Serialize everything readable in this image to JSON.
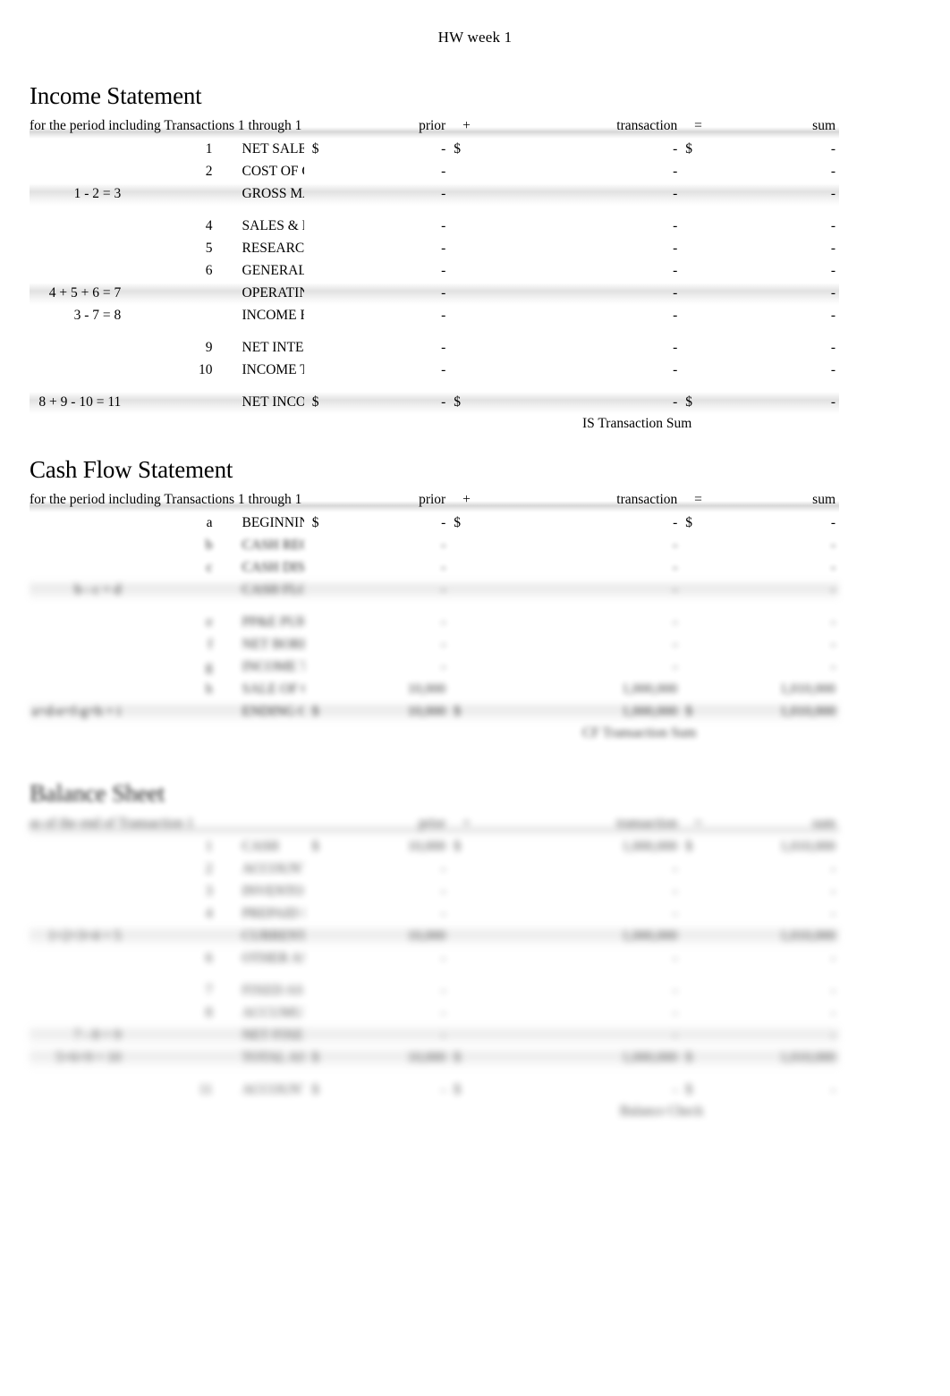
{
  "document": {
    "header_title": "HW week 1"
  },
  "columns": {
    "prior": "prior",
    "plus": "+",
    "transaction": "transaction",
    "equals": "=",
    "sum": "sum",
    "currency": "$",
    "dash": "-"
  },
  "income_statement": {
    "title": "Income Statement",
    "period": "for the period including Transactions 1 through 1",
    "footnote": "IS Transaction Sum",
    "rows": [
      {
        "ref": "",
        "code": "1",
        "label": "NET SALES",
        "cur1": "$",
        "prior": "-",
        "cur2": "$",
        "transaction": "-",
        "cur3": "$",
        "sum": "-",
        "band": false,
        "spacer_before": false
      },
      {
        "ref": "",
        "code": "2",
        "label": "COST OF GOODS SOLD",
        "cur1": "",
        "prior": "-",
        "cur2": "",
        "transaction": "-",
        "cur3": "",
        "sum": "-",
        "band": false,
        "spacer_before": false
      },
      {
        "ref": "1 - 2 = 3",
        "code": "",
        "label": "GROSS MARGIN",
        "cur1": "",
        "prior": "-",
        "cur2": "",
        "transaction": "-",
        "cur3": "",
        "sum": "-",
        "band": true,
        "spacer_before": false
      },
      {
        "ref": "",
        "code": "4",
        "label": "SALES & MARKETING",
        "cur1": "",
        "prior": "-",
        "cur2": "",
        "transaction": "-",
        "cur3": "",
        "sum": "-",
        "band": false,
        "spacer_before": true
      },
      {
        "ref": "",
        "code": "5",
        "label": "RESEARCH & DEVELOPMENT",
        "cur1": "",
        "prior": "-",
        "cur2": "",
        "transaction": "-",
        "cur3": "",
        "sum": "-",
        "band": false,
        "spacer_before": false
      },
      {
        "ref": "",
        "code": "6",
        "label": "GENERAL & ADMINISTRATIVE",
        "cur1": "",
        "prior": "-",
        "cur2": "",
        "transaction": "-",
        "cur3": "",
        "sum": "-",
        "band": false,
        "spacer_before": false
      },
      {
        "ref": "4 + 5 + 6 = 7",
        "code": "",
        "label": "OPERATING EXPENSE",
        "cur1": "",
        "prior": "-",
        "cur2": "",
        "transaction": "-",
        "cur3": "",
        "sum": "-",
        "band": true,
        "spacer_before": false
      },
      {
        "ref": "3 - 7 = 8",
        "code": "",
        "label": "INCOME FROM OPERATIONS",
        "cur1": "",
        "prior": "-",
        "cur2": "",
        "transaction": "-",
        "cur3": "",
        "sum": "-",
        "band": false,
        "spacer_before": false
      },
      {
        "ref": "",
        "code": "9",
        "label": "NET INTEREST INCOME",
        "cur1": "",
        "prior": "-",
        "cur2": "",
        "transaction": "-",
        "cur3": "",
        "sum": "-",
        "band": false,
        "spacer_before": true
      },
      {
        "ref": "",
        "code": "10",
        "label": "INCOME TAXES",
        "cur1": "",
        "prior": "-",
        "cur2": "",
        "transaction": "-",
        "cur3": "",
        "sum": "-",
        "band": false,
        "spacer_before": false
      },
      {
        "ref": "8 + 9 - 10 = 11",
        "code": "",
        "label": "NET INCOME",
        "cur1": "$",
        "prior": "-",
        "cur2": "$",
        "transaction": "-",
        "cur3": "$",
        "sum": "-",
        "band": true,
        "spacer_before": true
      }
    ]
  },
  "cash_flow_statement": {
    "title": "Cash Flow Statement",
    "period": "for the period including Transactions 1 through 1",
    "footnote": "CF Transaction Sum",
    "rows": [
      {
        "ref": "",
        "code": "a",
        "label": "BEGINNING CASH BALANCE",
        "cur1": "$",
        "prior": "-",
        "cur2": "$",
        "transaction": "-",
        "cur3": "$",
        "sum": "-",
        "blur": "none",
        "band": false,
        "spacer_before": false
      },
      {
        "ref": "",
        "code": "b",
        "label": "CASH RECEIPTS",
        "cur1": "",
        "prior": "-",
        "cur2": "",
        "transaction": "-",
        "cur3": "",
        "sum": "-",
        "blur": "a",
        "band": false,
        "spacer_before": false
      },
      {
        "ref": "",
        "code": "c",
        "label": "CASH DISBURSEMENTS",
        "cur1": "",
        "prior": "-",
        "cur2": "",
        "transaction": "-",
        "cur3": "",
        "sum": "-",
        "blur": "a",
        "band": false,
        "spacer_before": false
      },
      {
        "ref": "b - c = d",
        "code": "",
        "label": "CASH FLOW FROM OPERATIONS",
        "cur1": "",
        "prior": "-",
        "cur2": "",
        "transaction": "-",
        "cur3": "",
        "sum": "-",
        "blur": "b",
        "band": true,
        "spacer_before": false
      },
      {
        "ref": "",
        "code": "e",
        "label": "PP&E PURCHASE",
        "cur1": "",
        "prior": "-",
        "cur2": "",
        "transaction": "-",
        "cur3": "",
        "sum": "-",
        "blur": "b",
        "band": false,
        "spacer_before": true
      },
      {
        "ref": "",
        "code": "f",
        "label": "NET BORROWINGS",
        "cur1": "",
        "prior": "-",
        "cur2": "",
        "transaction": "-",
        "cur3": "",
        "sum": "-",
        "blur": "b",
        "band": false,
        "spacer_before": false
      },
      {
        "ref": "",
        "code": "g",
        "label": "INCOME TAXES PAID",
        "cur1": "",
        "prior": "-",
        "cur2": "",
        "transaction": "-",
        "cur3": "",
        "sum": "-",
        "blur": "b",
        "band": false,
        "spacer_before": false
      },
      {
        "ref": "",
        "code": "h",
        "label": "SALE OF CAPITAL STOCK",
        "cur1": "",
        "prior": "10,000",
        "cur2": "",
        "transaction": "1,000,000",
        "cur3": "",
        "sum": "1,010,000",
        "blur": "c",
        "band": false,
        "spacer_before": false
      },
      {
        "ref": "a+d-e+f-g+h = i",
        "code": "",
        "label": "ENDING CASH BALANCE",
        "cur1": "$",
        "prior": "10,000",
        "cur2": "$",
        "transaction": "1,000,000",
        "cur3": "$",
        "sum": "1,010,000",
        "blur": "c",
        "band": true,
        "spacer_before": false
      }
    ]
  },
  "balance_sheet": {
    "title": "Balance Sheet",
    "period": "as of the end of Transaction 1",
    "footnote": "Balance Check",
    "rows": [
      {
        "ref": "",
        "code": "1",
        "label": "CASH",
        "cur1": "$",
        "prior": "10,000",
        "cur2": "$",
        "transaction": "1,000,000",
        "cur3": "$",
        "sum": "1,010,000",
        "blur": "d",
        "band": false,
        "spacer_before": false
      },
      {
        "ref": "",
        "code": "2",
        "label": "ACCOUNTS RECEIVABLE",
        "cur1": "",
        "prior": "-",
        "cur2": "",
        "transaction": "-",
        "cur3": "",
        "sum": "-",
        "blur": "d",
        "band": false,
        "spacer_before": false
      },
      {
        "ref": "",
        "code": "3",
        "label": "INVENTORIES",
        "cur1": "",
        "prior": "-",
        "cur2": "",
        "transaction": "-",
        "cur3": "",
        "sum": "-",
        "blur": "d",
        "band": false,
        "spacer_before": false
      },
      {
        "ref": "",
        "code": "4",
        "label": "PREPAID EXPENSES",
        "cur1": "",
        "prior": "-",
        "cur2": "",
        "transaction": "-",
        "cur3": "",
        "sum": "-",
        "blur": "e",
        "band": false,
        "spacer_before": false
      },
      {
        "ref": "1+2+3+4 = 5",
        "code": "",
        "label": "CURRENT ASSETS",
        "cur1": "",
        "prior": "10,000",
        "cur2": "",
        "transaction": "1,000,000",
        "cur3": "",
        "sum": "1,010,000",
        "blur": "e",
        "band": true,
        "spacer_before": false
      },
      {
        "ref": "",
        "code": "6",
        "label": "OTHER ASSETS",
        "cur1": "",
        "prior": "-",
        "cur2": "",
        "transaction": "-",
        "cur3": "",
        "sum": "-",
        "blur": "e",
        "band": false,
        "spacer_before": false
      },
      {
        "ref": "",
        "code": "7",
        "label": "FIXED ASSETS AT COST",
        "cur1": "",
        "prior": "-",
        "cur2": "",
        "transaction": "-",
        "cur3": "",
        "sum": "-",
        "blur": "f",
        "band": false,
        "spacer_before": true
      },
      {
        "ref": "",
        "code": "8",
        "label": "ACCUMULATED DEPRECIATION",
        "cur1": "",
        "prior": "-",
        "cur2": "",
        "transaction": "-",
        "cur3": "",
        "sum": "-",
        "blur": "f",
        "band": false,
        "spacer_before": false
      },
      {
        "ref": "7 - 8 = 9",
        "code": "",
        "label": "NET FIXED ASSETS",
        "cur1": "",
        "prior": "-",
        "cur2": "",
        "transaction": "-",
        "cur3": "",
        "sum": "-",
        "blur": "f",
        "band": true,
        "spacer_before": false
      },
      {
        "ref": "5+6+9 = 10",
        "code": "",
        "label": "TOTAL ASSETS",
        "cur1": "$",
        "prior": "10,000",
        "cur2": "$",
        "transaction": "1,000,000",
        "cur3": "$",
        "sum": "1,010,000",
        "blur": "f",
        "band": true,
        "spacer_before": false
      },
      {
        "ref": "",
        "code": "11",
        "label": "ACCOUNTS PAYABLE",
        "cur1": "$",
        "prior": "-",
        "cur2": "$",
        "transaction": "-",
        "cur3": "$",
        "sum": "-",
        "blur": "f",
        "band": false,
        "spacer_before": true
      }
    ]
  }
}
